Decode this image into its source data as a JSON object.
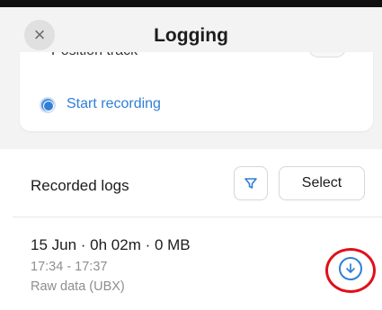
{
  "header": {
    "title": "Logging",
    "close_icon": "close-icon",
    "close_glyph": "×"
  },
  "card": {
    "cutoff_text": "• Position track",
    "start_label": "Start recording"
  },
  "recorded_logs": {
    "title": "Recorded logs",
    "filter_icon": "filter-icon",
    "select_label": "Select",
    "items": [
      {
        "title": "15 Jun · 0h 02m · 0 MB",
        "time": "17:34 - 17:37",
        "type": "Raw data (UBX)",
        "action_icon": "download-icon"
      }
    ]
  },
  "colors": {
    "accent": "#2f7fd6",
    "highlight_ring": "#e0101a",
    "background": "#f3f3f3"
  }
}
